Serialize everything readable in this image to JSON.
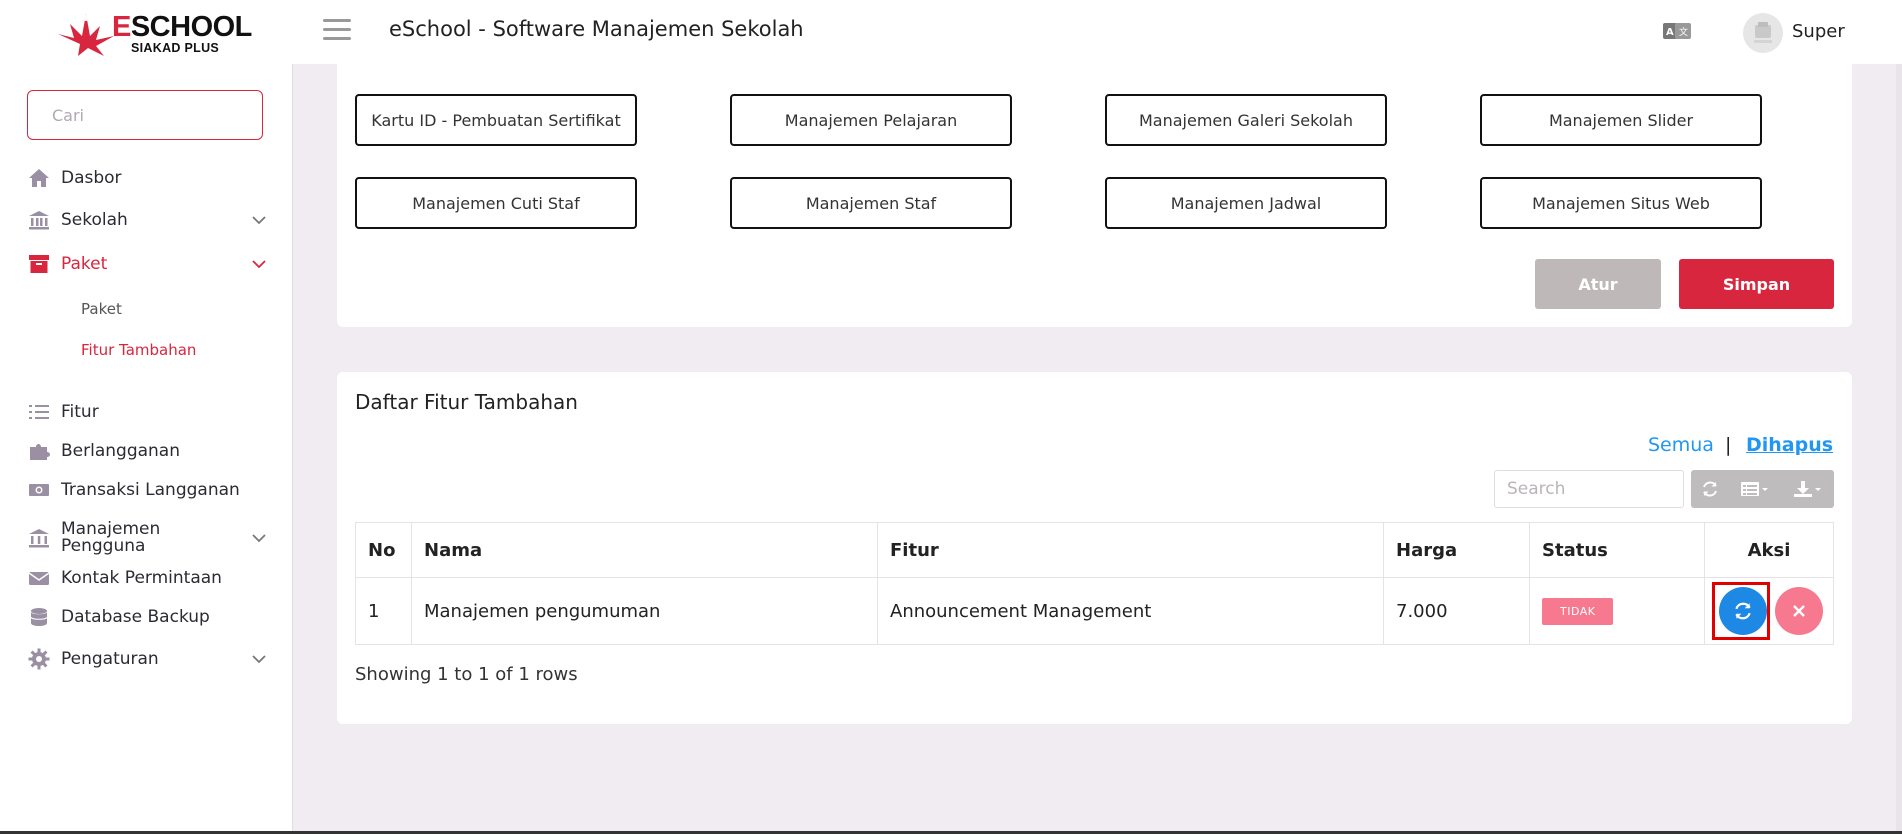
{
  "header": {
    "logo_title_e": "E",
    "logo_title_rest": "SCHOOL",
    "logo_subtitle": "SIAKAD PLUS",
    "app_title": "eSchool - Software Manajemen Sekolah",
    "user_name": "Super"
  },
  "sidebar": {
    "search_placeholder": "Cari",
    "items": [
      {
        "label": "Dasbor",
        "icon": "home-icon"
      },
      {
        "label": "Sekolah",
        "icon": "bank-icon"
      },
      {
        "label": "Paket",
        "icon": "archive-icon"
      },
      {
        "label": "Fitur",
        "icon": "list-icon"
      },
      {
        "label": "Berlangganan",
        "icon": "puzzle-icon"
      },
      {
        "label": "Transaksi Langganan",
        "icon": "money-icon"
      },
      {
        "label": "Manajemen Pengguna",
        "icon": "users-building-icon"
      },
      {
        "label": "Kontak Permintaan",
        "icon": "envelope-icon"
      },
      {
        "label": "Database Backup",
        "icon": "database-icon"
      },
      {
        "label": "Pengaturan",
        "icon": "gear-icon"
      }
    ],
    "sub_items": [
      {
        "label": "Paket"
      },
      {
        "label": "Fitur Tambahan"
      }
    ],
    "active_color": "#d7263d"
  },
  "features": {
    "buttons": [
      "Kartu ID - Pembuatan Sertifikat",
      "Manajemen Pelajaran",
      "Manajemen Galeri Sekolah",
      "Manajemen Slider",
      "Manajemen Cuti Staf",
      "Manajemen Staf",
      "Manajemen Jadwal",
      "Manajemen Situs Web"
    ],
    "atur_label": "Atur",
    "simpan_label": "Simpan"
  },
  "list": {
    "title": "Daftar Fitur Tambahan",
    "filter_all": "Semua",
    "filter_sep": "|",
    "filter_deleted": "Dihapus",
    "search_placeholder": "Search",
    "columns": [
      "No",
      "Nama",
      "Fitur",
      "Harga",
      "Status",
      "Aksi"
    ],
    "rows": [
      {
        "no": "1",
        "nama": "Manajemen pengumuman",
        "fitur": "Announcement Management",
        "harga": "7.000",
        "status": "TIDAK"
      }
    ],
    "footer": "Showing 1 to 1 of 1 rows"
  }
}
